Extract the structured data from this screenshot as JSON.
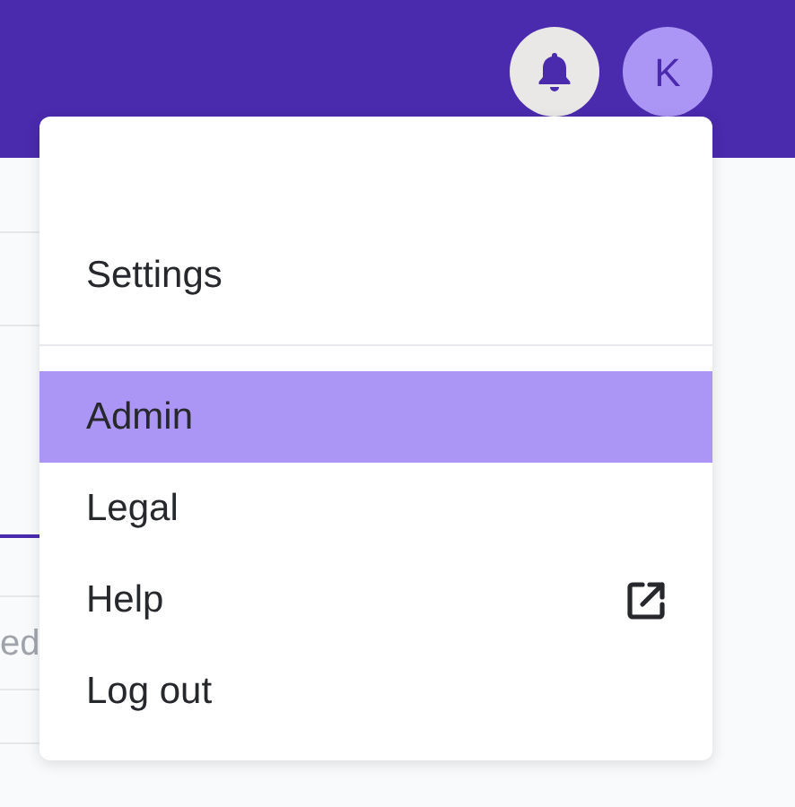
{
  "header": {
    "avatar": {
      "initial": "K"
    }
  },
  "background": {
    "partial_text": "ed"
  },
  "menu": {
    "sections": [
      [
        {
          "label": "Settings",
          "selected": false,
          "external": false
        }
      ],
      [
        {
          "label": "Admin",
          "selected": true,
          "external": false
        },
        {
          "label": "Legal",
          "selected": false,
          "external": false
        },
        {
          "label": "Help",
          "selected": false,
          "external": true
        },
        {
          "label": "Log out",
          "selected": false,
          "external": false
        }
      ]
    ]
  }
}
